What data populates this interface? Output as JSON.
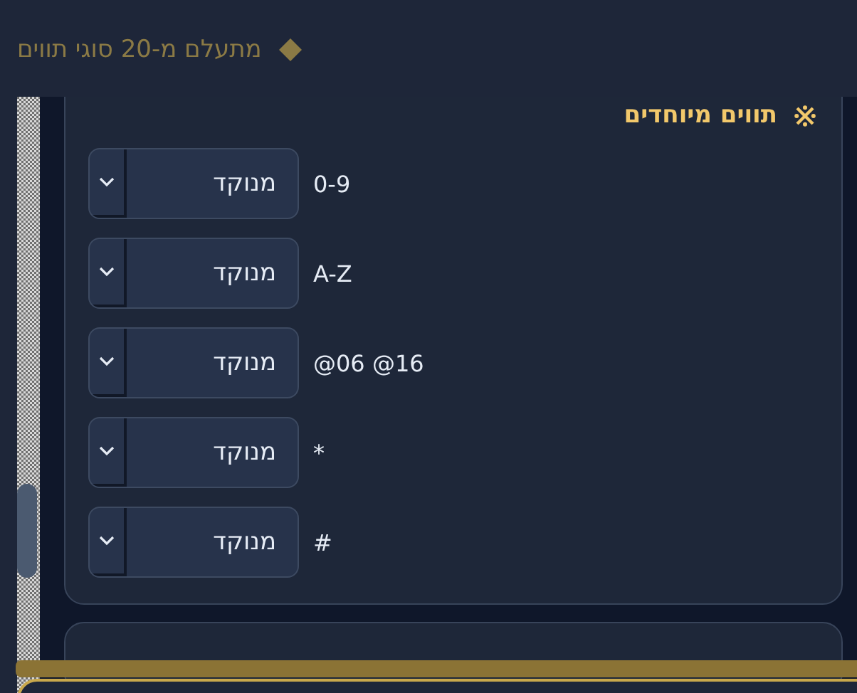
{
  "header": {
    "text": "מתעלם מ-20 סוגי תווים"
  },
  "section": {
    "title": "תווים מיוחדים",
    "rows": [
      {
        "label": "0-9",
        "value": "מנוקד"
      },
      {
        "label": "A-Z",
        "value": "מנוקד"
      },
      {
        "label": "@06 @16",
        "value": "מנוקד"
      },
      {
        "label": "*",
        "value": "מנוקד"
      },
      {
        "label": "#",
        "value": "מנוקד"
      }
    ]
  }
}
